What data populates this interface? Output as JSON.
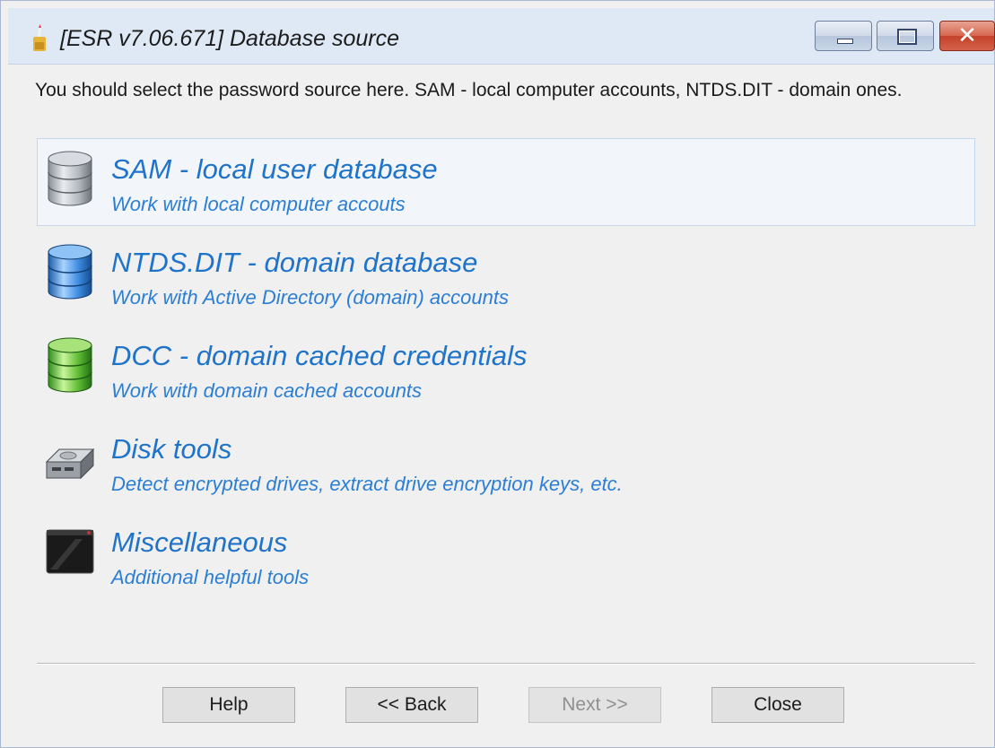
{
  "window": {
    "title": "[ESR v7.06.671]  Database source",
    "controls": {
      "minimize_icon": "minimize-icon",
      "maximize_icon": "maximize-icon",
      "close_glyph": "✕"
    }
  },
  "instruction": "You should select the password source here. SAM - local computer accounts, NTDS.DIT - domain ones.",
  "options": [
    {
      "title": "SAM - local user database",
      "description": "Work with local computer accouts",
      "icon": "gray-database-icon",
      "selected": true
    },
    {
      "title": "NTDS.DIT - domain database",
      "description": "Work with Active Directory (domain) accounts",
      "icon": "blue-database-icon",
      "selected": false
    },
    {
      "title": "DCC - domain cached credentials",
      "description": "Work with domain cached accounts",
      "icon": "green-database-icon",
      "selected": false
    },
    {
      "title": "Disk tools",
      "description": "Detect encrypted drives, extract drive encryption keys, etc.",
      "icon": "hard-drive-icon",
      "selected": false
    },
    {
      "title": "Miscellaneous",
      "description": "Additional helpful tools",
      "icon": "terminal-icon",
      "selected": false
    }
  ],
  "buttons": {
    "help": "Help",
    "back": "<< Back",
    "next": "Next >>",
    "close": "Close"
  },
  "colors": {
    "link_title": "#1f73c9",
    "link_desc": "#2b7ed3",
    "window_bg": "#f0f0f0"
  }
}
